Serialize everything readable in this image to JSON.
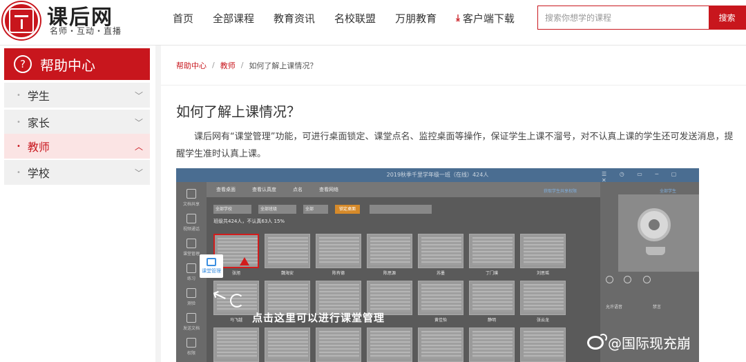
{
  "header": {
    "logo_title": "课后网",
    "logo_subtitle": "名师・互动・直播",
    "nav": [
      "首页",
      "全部课程",
      "教育资讯",
      "名校联盟",
      "万朋教育"
    ],
    "download_label": "客户端下载",
    "search_placeholder": "搜索你想学的课程",
    "search_button": "搜索"
  },
  "sidebar": {
    "title": "帮助中心",
    "items": [
      {
        "label": "学生",
        "active": false
      },
      {
        "label": "家长",
        "active": false
      },
      {
        "label": "教师",
        "active": true
      },
      {
        "label": "学校",
        "active": false
      }
    ]
  },
  "breadcrumb": {
    "items": [
      "帮助中心",
      "教师"
    ],
    "current": "如何了解上课情况？"
  },
  "article": {
    "title": "如何了解上课情况？",
    "body": "课后网有“课堂管理”功能，可进行桌面锁定、课堂点名、监控桌面等操作，保证学生上课不溜号，对不认真上课的学生还可发送消息，提醒学生准时认真上课。"
  },
  "screenshot": {
    "window_title": "2019秋季千里学年级一班（在线）424人",
    "tabs": [
      "查看桌面",
      "查看认真度",
      "点名",
      "查看网络"
    ],
    "select_1": "全部学校",
    "select_2": "全部班级",
    "select_3": "全部",
    "orange_button": "锁定桌面",
    "stats": "班级共424人，不认真63人  15%",
    "left_items": [
      "文档共享",
      "视频通话",
      "课堂管理",
      "练习",
      "测验",
      "发送文档",
      "权限"
    ],
    "student_names": [
      "张旭",
      "魏海安",
      "陈有德",
      "陈思源",
      "苏墨",
      "丁门璞",
      "刘思瑶",
      "马飞越",
      "",
      "",
      "",
      "黄佳怡",
      "静明",
      "张云龙"
    ],
    "right_texts": [
      "获取学生共享权限",
      "全部学生",
      "允许语音",
      "禁言"
    ],
    "callout_label": "课堂管理",
    "caption": "点击这里可以进行课堂管理"
  },
  "watermark": "@国际现充崩",
  "colors": {
    "brand_red": "#c8161d",
    "active_bg": "#fbe4e4",
    "sidebar_item_bg": "#f0f0f0"
  }
}
